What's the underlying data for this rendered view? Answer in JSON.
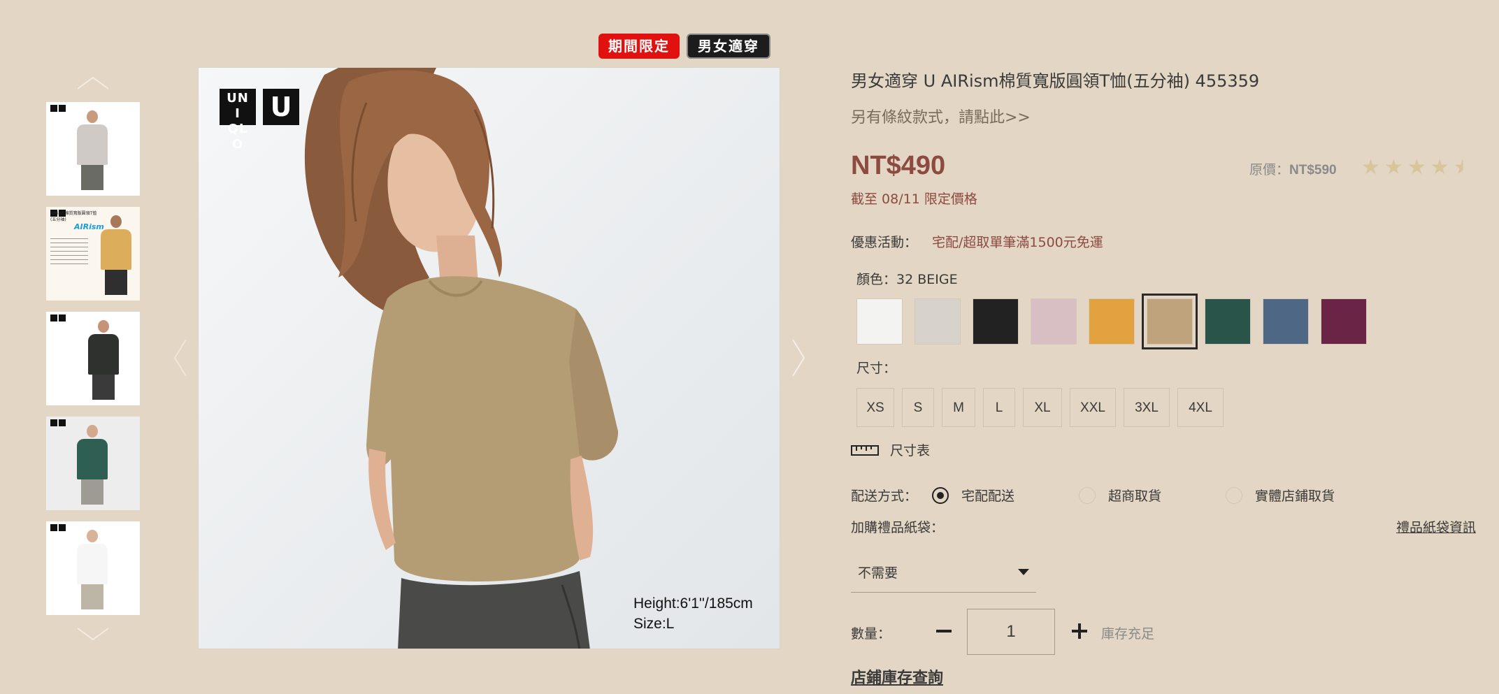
{
  "badges": {
    "limited": "期間限定",
    "unisex": "男女適穿"
  },
  "thumbnails": [
    {
      "name": "thumb-1-gray-tee",
      "shirt": "#cfcac6",
      "skin": "#c89a7e",
      "pants": "#6b6b66",
      "bg": "#ffffff"
    },
    {
      "name": "thumb-2-airism-info",
      "shirt": "#dcae5c",
      "skin": "#a7785a",
      "pants": "#2f2f2f",
      "bg": "#fbf6ee"
    },
    {
      "name": "thumb-3-dark-shirt",
      "shirt": "#2f312f",
      "skin": "#c59478",
      "pants": "#3a3a3a",
      "bg": "#ffffff"
    },
    {
      "name": "thumb-4-green-tee",
      "shirt": "#2f5e52",
      "skin": "#d2a88e",
      "pants": "#9e9b94",
      "bg": "#ededed"
    },
    {
      "name": "thumb-5-white-tee",
      "shirt": "#f6f6f6",
      "skin": "#d8b39a",
      "pants": "#bdb6a6",
      "bg": "#ffffff"
    }
  ],
  "thumb2_text": "AIRism棉質寬版圓領T恤(五分袖)",
  "thumb2_brand": "AIRism",
  "main_image": {
    "logo_text": "UNI QLO",
    "logo_u": "U",
    "caption_line1": "Height:6'1''/185cm",
    "caption_line2": "Size:L"
  },
  "product": {
    "title": "男女適穿 U AIRism棉質寬版圓領T恤(五分袖) 455359",
    "subtitle": "另有條紋款式，請點此>>",
    "price": "NT$490",
    "limit_text": "截至 08/11 限定價格",
    "original_label": "原價：",
    "original_price": "NT$590",
    "rating": 4.5
  },
  "promo": {
    "label": "優惠活動：",
    "text": "宅配/超取單筆滿1500元免運"
  },
  "color": {
    "label": "顏色：32 BEIGE",
    "swatches": [
      {
        "name": "white",
        "hex": "#f3f3f1"
      },
      {
        "name": "light-gray",
        "hex": "#d7d3cc"
      },
      {
        "name": "black",
        "hex": "#222222"
      },
      {
        "name": "pink",
        "hex": "#d7bfc4"
      },
      {
        "name": "yellow",
        "hex": "#e2a23f"
      },
      {
        "name": "beige",
        "hex": "#bfa37c",
        "selected": true
      },
      {
        "name": "green",
        "hex": "#285449"
      },
      {
        "name": "blue",
        "hex": "#4e6784"
      },
      {
        "name": "wine",
        "hex": "#6a2445"
      }
    ]
  },
  "size": {
    "label": "尺寸：",
    "options": [
      "XS",
      "S",
      "M",
      "L",
      "XL",
      "XXL",
      "3XL",
      "4XL"
    ]
  },
  "size_chart": "尺寸表",
  "shipping": {
    "label": "配送方式：",
    "options": [
      "宅配配送",
      "超商取貨",
      "實體店鋪取貨"
    ]
  },
  "gift": {
    "label": "加購禮品紙袋：",
    "link": "禮品紙袋資訊",
    "select_value": "不需要"
  },
  "quantity": {
    "label": "數量：",
    "value": "1",
    "stock": "庫存充足"
  },
  "store_link": "店鋪庫存查詢"
}
